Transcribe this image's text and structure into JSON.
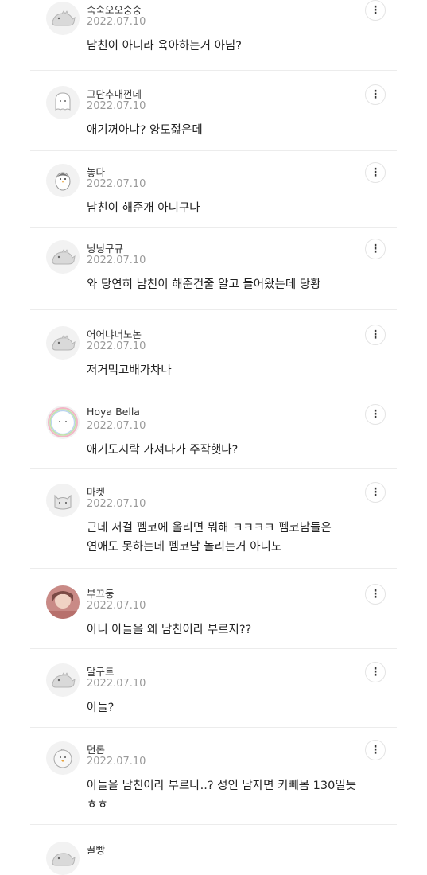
{
  "comments": [
    {
      "nickname": "숙숙오오숭숭",
      "date": "2022.07.10",
      "lines": [
        "남친이 아니라 육아하는거 아님?"
      ],
      "avatar": "dinosaur-icon"
    },
    {
      "nickname": "그단추내껀데",
      "date": "2022.07.10",
      "lines": [
        "애기꺼아냐? 양도젎은데"
      ],
      "avatar": "ghost-icon"
    },
    {
      "nickname": "놓다",
      "date": "2022.07.10",
      "lines": [
        "남친이 해준개 아니구나"
      ],
      "avatar": "penguin-icon"
    },
    {
      "nickname": "닝닝구규",
      "date": "2022.07.10",
      "lines": [
        "와 당연히 남친이 해준건줄 알고 들어왔는데 당황"
      ],
      "avatar": "dinosaur-icon"
    },
    {
      "nickname": "어어냐너노논",
      "date": "2022.07.10",
      "lines": [
        "저거먹고배가차나"
      ],
      "avatar": "dinosaur-icon"
    },
    {
      "nickname": "Hoya Bella",
      "date": "2022.07.10",
      "lines": [
        "애기도시락 가져다가 주작햇나?"
      ],
      "avatar": "rainbow-ghost-icon"
    },
    {
      "nickname": "마켓",
      "date": "2022.07.10",
      "lines": [
        "근데 저걸 펨코에 올리면 뭐해 ㅋㅋㅋㅋ 펨코남들은",
        "연애도 못하는데 펨코남 놀리는거 아니노"
      ],
      "avatar": "cat-icon"
    },
    {
      "nickname": "부끄둥",
      "date": "2022.07.10",
      "lines": [
        "아니 아들을 왜 남친이라 부르지??"
      ],
      "avatar": "photo-avatar"
    },
    {
      "nickname": "달구트",
      "date": "2022.07.10",
      "lines": [
        "아들?"
      ],
      "avatar": "dinosaur-icon"
    },
    {
      "nickname": "던롭",
      "date": "2022.07.10",
      "lines": [
        "아들을 남친이라 부르나..? 성인 남자면 키빼몸 130일듯",
        "ㅎㅎ"
      ],
      "avatar": "chick-icon"
    },
    {
      "nickname": "꿀빵",
      "date": "",
      "lines": [],
      "avatar": "dinosaur-icon"
    }
  ],
  "more_label": "⋮"
}
